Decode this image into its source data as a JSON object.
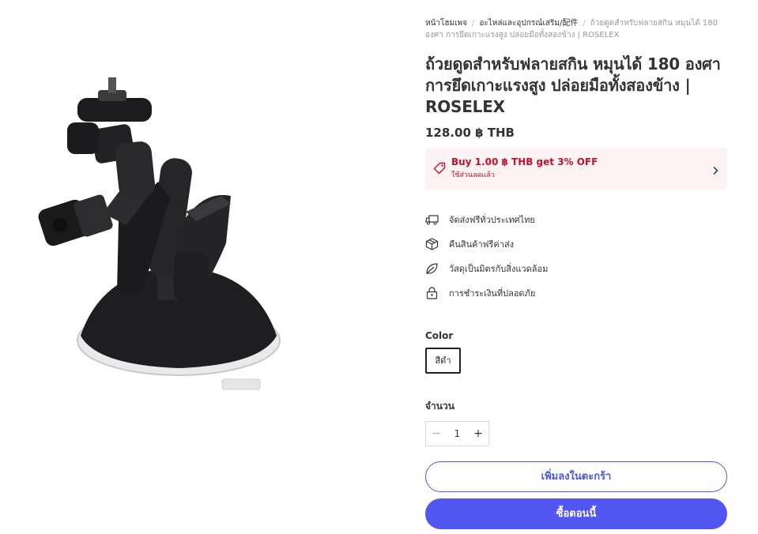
{
  "breadcrumb": {
    "home": "หน้าโฮมเพจ",
    "category": "อะไหล่และอุปกรณ์เสริม/配件",
    "current": "ถ้วยดูดสำหรับฟลายสกิน หมุนได้ 180 องศา การยึดเกาะแรงสูง ปล่อยมือทั้งสองข้าง | ROSELEX"
  },
  "product": {
    "title": "ถ้วยดูดสำหรับฟลายสกิน หมุนได้ 180 องศา การยึดเกาะแรงสูง ปล่อยมือทั้งสองข้าง | ROSELEX",
    "price": "128.00 ฿ THB",
    "image_icon": "suction-cup-mount-photo"
  },
  "promo": {
    "title": "Buy 1.00 ฿ THB get 3% OFF",
    "subtitle": "ใช้ส่วนลดแล้ว",
    "accent": "#c0122b",
    "icon": "tag-icon"
  },
  "features": [
    {
      "label": "จัดส่งฟรีทั่วประเทศไทย",
      "icon": "truck-icon"
    },
    {
      "label": "คืนสินค้าฟรีค่าส่ง",
      "icon": "box-icon"
    },
    {
      "label": "วัสดุเป็นมิตรกับสิ่งแวดล้อม",
      "icon": "leaf-icon"
    },
    {
      "label": "การชำระเงินที่ปลอดภัย",
      "icon": "lock-icon"
    }
  ],
  "color_option": {
    "label": "Color",
    "selected": "สีดำ"
  },
  "quantity": {
    "label": "จำนวน",
    "value": "1",
    "minus": "−",
    "plus": "+"
  },
  "actions": {
    "add_to_cart": "เพิ่มลงในตะกร้า",
    "buy_now": "ซื้อตอนนี้",
    "brand_color": "#5256f0"
  }
}
